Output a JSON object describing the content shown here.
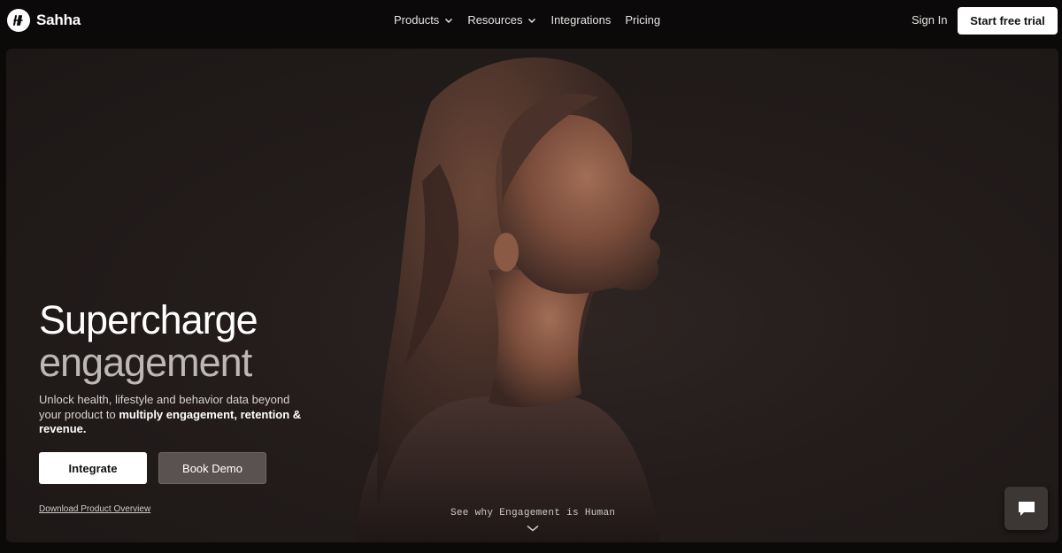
{
  "brand": {
    "name": "Sahha"
  },
  "nav": {
    "items": [
      {
        "label": "Products",
        "dropdown": true
      },
      {
        "label": "Resources",
        "dropdown": true
      },
      {
        "label": "Integrations",
        "dropdown": false
      },
      {
        "label": "Pricing",
        "dropdown": false
      }
    ],
    "sign_in": "Sign In",
    "cta": "Start free trial"
  },
  "hero": {
    "headline_line1": "Supercharge",
    "headline_line2": "engagement",
    "sub_plain": "Unlock health, lifestyle and behavior data beyond your product to ",
    "sub_bold": "multiply engagement, retention & revenue.",
    "primary_button": "Integrate",
    "secondary_button": "Book Demo",
    "download_link": "Download Product Overview",
    "scroll_hint": "See why Engagement is Human"
  },
  "colors": {
    "background": "#0c0a09",
    "hero_bg": "#231c1b",
    "portrait_skin": "#8a5a45",
    "button_primary_bg": "#ffffff",
    "button_secondary_bg": "#5a5250"
  },
  "icons": {
    "logo": "sahha-logo-icon",
    "dropdown": "chevron-down-icon",
    "scroll": "chevron-down-icon",
    "chat": "chat-bubble-icon"
  }
}
